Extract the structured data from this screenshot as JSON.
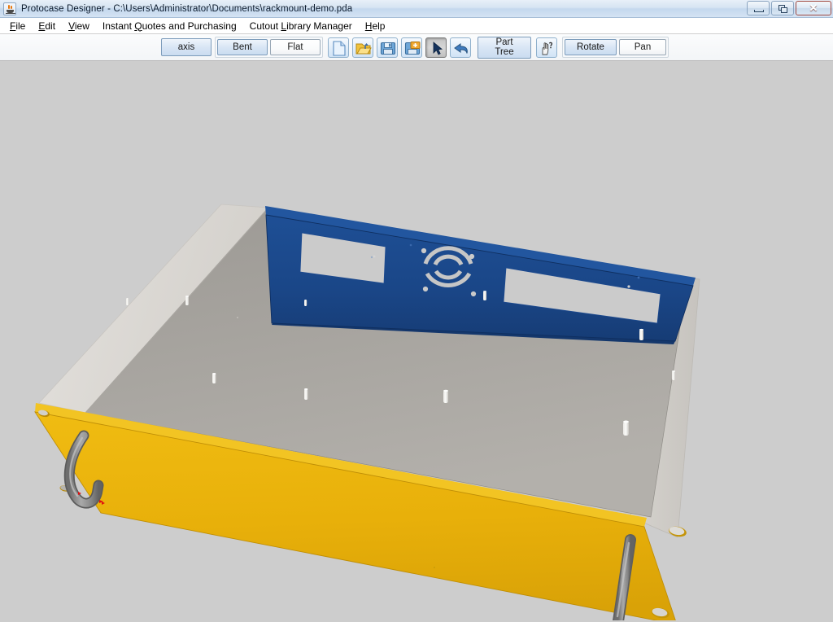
{
  "window": {
    "title": "Protocase Designer - C:\\Users\\Administrator\\Documents\\rackmount-demo.pda",
    "app_icon": "java-coffee-cup-icon",
    "controls": {
      "minimize": "minimize-icon",
      "restore": "restore-icon",
      "close_label": "✕"
    }
  },
  "menubar": {
    "items": [
      {
        "mnemonic": "F",
        "rest": "ile",
        "name": "file"
      },
      {
        "mnemonic": "E",
        "rest": "dit",
        "name": "edit"
      },
      {
        "mnemonic": "V",
        "rest": "iew",
        "name": "view"
      },
      {
        "pre": "Instant ",
        "mnemonic": "Q",
        "rest": "uotes and Purchasing",
        "name": "instant-quotes-and-purchasing"
      },
      {
        "pre": "Cutout ",
        "mnemonic": "L",
        "rest": "ibrary Manager",
        "name": "cutout-library-manager"
      },
      {
        "mnemonic": "H",
        "rest": "elp",
        "name": "help"
      }
    ]
  },
  "toolbar": {
    "axis_label": "axis",
    "axis_active": true,
    "view_mode": {
      "bent_label": "Bent",
      "flat_label": "Flat",
      "selected": "Bent"
    },
    "icons": [
      {
        "name": "new-file-icon",
        "tooltip": "New"
      },
      {
        "name": "open-folder-icon",
        "tooltip": "Open"
      },
      {
        "name": "save-floppy-icon",
        "tooltip": "Save"
      },
      {
        "name": "save-as-floppy-plus-icon",
        "tooltip": "Save As"
      },
      {
        "name": "select-cursor-icon",
        "tooltip": "Select",
        "pressed": true
      },
      {
        "name": "undo-arrow-icon",
        "tooltip": "Undo"
      }
    ],
    "part_tree_label_line1": "Part",
    "part_tree_label_line2": "Tree",
    "help_cursor_icon": "hand-question-mark-icon",
    "navigation": {
      "rotate_label": "Rotate",
      "pan_label": "Pan",
      "selected": "Rotate"
    }
  },
  "canvas": {
    "background_color": "#cdcdcd",
    "model_name": "rackmount-demo",
    "parts": [
      {
        "name": "front-panel",
        "color": "#e8b10a",
        "label": "Front Panel (yellow)"
      },
      {
        "name": "rear-panel",
        "color": "#1b4b8f",
        "label": "Rear Panel (blue)"
      },
      {
        "name": "base-plate",
        "color": "#a8a59f",
        "label": "Base Plate (grey)"
      },
      {
        "name": "left-side-wall",
        "color": "#dedbd6",
        "label": "Left Side Wall"
      },
      {
        "name": "right-side-wall",
        "color": "#cecbc6",
        "label": "Right Side Wall"
      },
      {
        "name": "handle-left",
        "color": "#8a8a8a",
        "label": "Handle Left"
      },
      {
        "name": "handle-right",
        "color": "#8a8a8a",
        "label": "Handle Right"
      }
    ],
    "features": {
      "fan_grille": "fan-grille-cutout",
      "rect_cutout_left": "rectangular-cutout",
      "rect_cutout_right": "rectangular-cutout",
      "standoffs": "pem-standoff",
      "mounting_slots": "oval-mounting-slot",
      "axis_indicator_color": "#e01010"
    }
  }
}
